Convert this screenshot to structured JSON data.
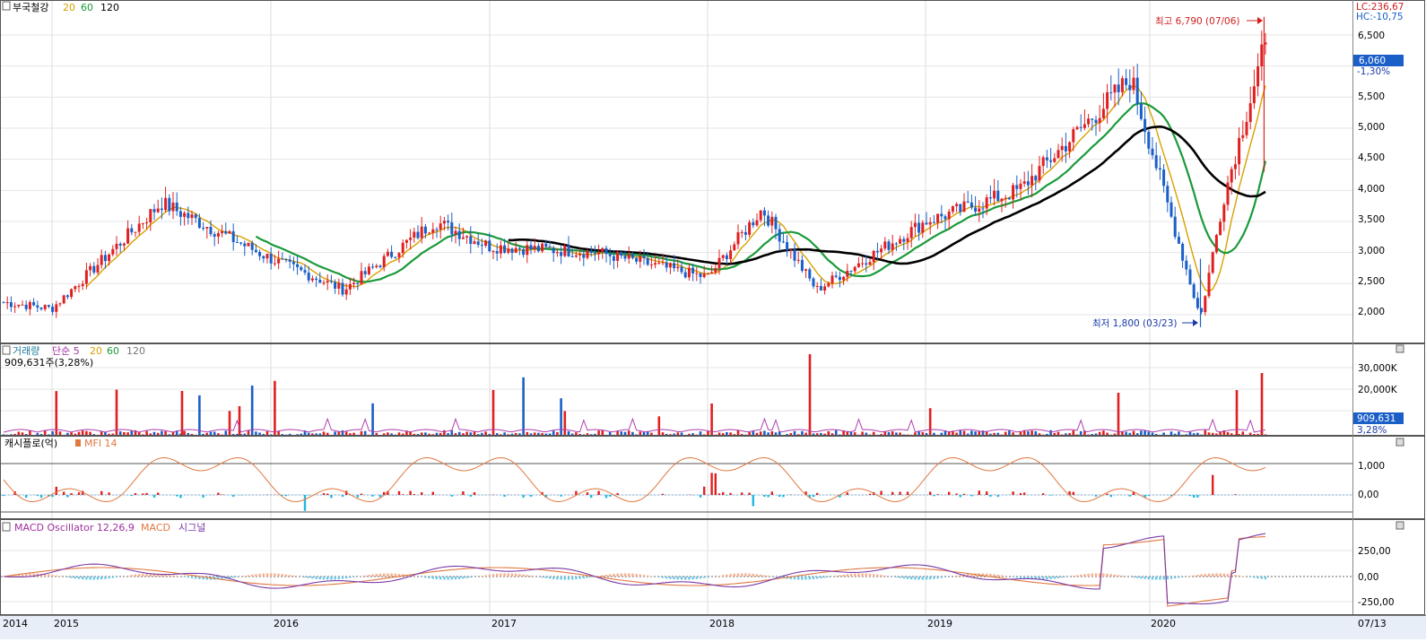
{
  "price_pane": {
    "stock_name": "부국철강",
    "ma_legend": [
      {
        "label": "20",
        "color": "#d8a000"
      },
      {
        "label": "60",
        "color": "#1a9a3a"
      },
      {
        "label": "120",
        "color": "#000000"
      }
    ],
    "top_right_lc": "LC:236,67",
    "top_right_hc": "HC:-10,75",
    "high_label": "최고 6,790 (07/06)",
    "low_label": "최저 1,800 (03/23)",
    "current_price_tag": "6,060",
    "current_change": "-1,30%",
    "y_ticks": [
      "6,500",
      "6,000",
      "5,500",
      "5,000",
      "4,500",
      "4,000",
      "3,500",
      "3,000",
      "2,500",
      "2,000"
    ]
  },
  "volume_pane": {
    "title": "거래량",
    "ma_label": "단순 5",
    "ma_periods": [
      "20",
      "60",
      "120"
    ],
    "value_label": "909,631주(3,28%)",
    "current_tag": "909,631",
    "current_pct": "3,28%",
    "y_ticks": [
      "30,000K",
      "20,000K",
      "10,000K"
    ]
  },
  "cashflow_pane": {
    "title": "캐시플로(억)",
    "indicator": "MFI 14",
    "y_ticks": [
      "1,000",
      "0,00"
    ]
  },
  "macd_pane": {
    "title": "MACD Oscillator 12,26,9",
    "macd_label": "MACD",
    "signal_label": "시그널",
    "y_ticks": [
      "250,00",
      "0,00",
      "-250,00"
    ]
  },
  "x_axis": {
    "year_labels": [
      "2014",
      "2015",
      "2016",
      "2017",
      "2018",
      "2019",
      "2020"
    ],
    "end_label": "07/13"
  },
  "colors": {
    "up": "#e02020",
    "down": "#1a5fc8",
    "ma20": "#d8a000",
    "ma60": "#1a9a3a",
    "ma120": "#000000",
    "mfi": "#e07840",
    "macd": "#e07840",
    "signal": "#7a3aa8",
    "osc_up": "#f4b090",
    "osc_down": "#70c8e8"
  },
  "chart_data": {
    "type": "candlestick",
    "period": "2014 - 2020-07-13",
    "price_key_points": [
      {
        "date": "2015",
        "close": 2100
      },
      {
        "date": "2015-07",
        "close": 3800
      },
      {
        "date": "2016",
        "close": 2900
      },
      {
        "date": "2016-05",
        "close": 2400
      },
      {
        "date": "2016-10",
        "close": 3500
      },
      {
        "date": "2017-01",
        "close": 3100
      },
      {
        "date": "2017-07",
        "close": 3000
      },
      {
        "date": "2018-01",
        "close": 2600
      },
      {
        "date": "2018-04",
        "close": 3700
      },
      {
        "date": "2018-07",
        "close": 2400
      },
      {
        "date": "2019-01",
        "close": 3500
      },
      {
        "date": "2019-06",
        "close": 4000
      },
      {
        "date": "2019-12",
        "close": 5800
      },
      {
        "date": "2020-03-23",
        "low": 1800
      },
      {
        "date": "2020-05",
        "close": 3900
      },
      {
        "date": "2020-07-06",
        "high": 6790
      },
      {
        "date": "2020-07-13",
        "close": 6060
      }
    ],
    "all_time_high": {
      "value": 6790,
      "date": "07/06"
    },
    "all_time_low": {
      "value": 1800,
      "date": "03/23"
    },
    "last_close": 6060,
    "last_change_pct": -1.3,
    "last_volume": 909631,
    "last_volume_pct": 3.28,
    "price_ylim": [
      1500,
      7000
    ]
  }
}
